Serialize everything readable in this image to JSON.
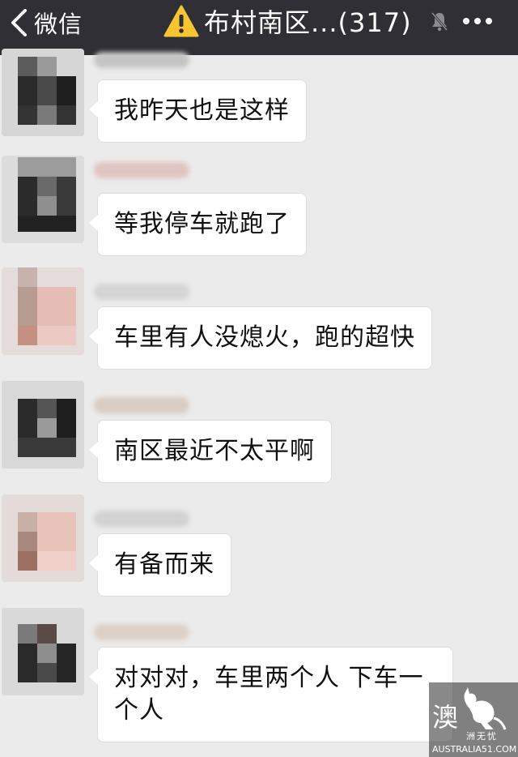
{
  "header": {
    "back_label": "微信",
    "title": "布村南区...(317)",
    "icons": {
      "back": "chevron-left-icon",
      "warning": "warning-icon",
      "mute": "mute-bell-icon",
      "more": "more-dots-icon"
    }
  },
  "messages": [
    {
      "text": "我昨天也是这样"
    },
    {
      "text": "等我停车就跑了"
    },
    {
      "text": "车里有人没熄火，跑的超快"
    },
    {
      "text": "南区最近不太平啊"
    },
    {
      "text": "有备而来"
    },
    {
      "text": "对对对，车里两个人 下车一个人"
    }
  ],
  "watermark": {
    "big": "澳",
    "small": "洲无忧",
    "url": "AUSTRALIA51.COM"
  },
  "colors": {
    "nav_bg": "#2f2f35",
    "chat_bg": "#ebebeb",
    "bubble_bg": "#ffffff",
    "warning": "#f7c531"
  }
}
